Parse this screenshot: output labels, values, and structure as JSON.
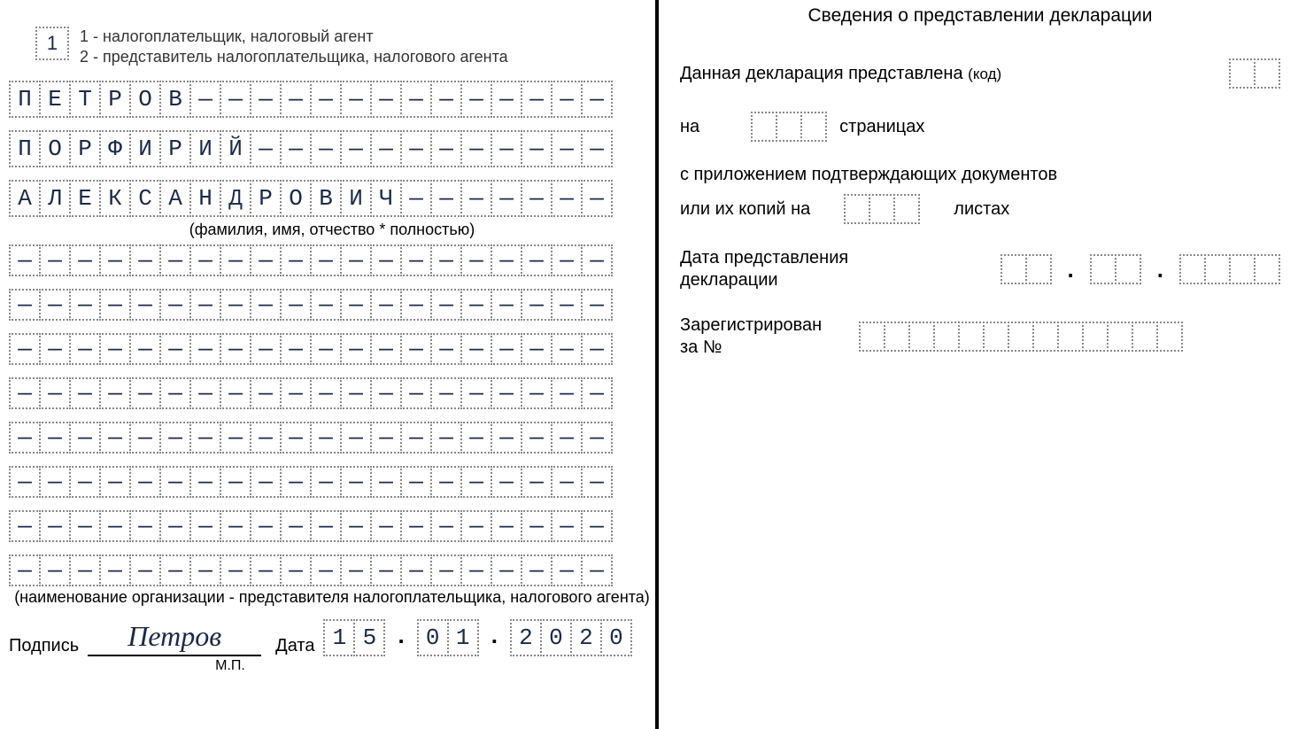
{
  "signer_type_code": "1",
  "legend_line1": "1 - налогоплательщик, налоговый агент",
  "legend_line2": "2 - представитель налогоплательщика, налогового агента",
  "surname_row": [
    "П",
    "Е",
    "Т",
    "Р",
    "О",
    "В",
    "—",
    "—",
    "—",
    "—",
    "—",
    "—",
    "—",
    "—",
    "—",
    "—",
    "—",
    "—",
    "—",
    "—"
  ],
  "name_row": [
    "П",
    "О",
    "Р",
    "Ф",
    "И",
    "Р",
    "И",
    "Й",
    "—",
    "—",
    "—",
    "—",
    "—",
    "—",
    "—",
    "—",
    "—",
    "—",
    "—",
    "—"
  ],
  "patronymic_row": [
    "А",
    "Л",
    "Е",
    "К",
    "С",
    "А",
    "Н",
    "Д",
    "Р",
    "О",
    "В",
    "И",
    "Ч",
    "—",
    "—",
    "—",
    "—",
    "—",
    "—",
    "—"
  ],
  "fio_caption": "(фамилия, имя, отчество * полностью)",
  "empty_rows_count": 8,
  "empty_row_cells": 20,
  "org_caption": "(наименование организации - представителя налогоплательщика, налогового агента)",
  "sign_label": "Подпись",
  "signature_value": "Петров",
  "date_label": "Дата",
  "mp_label": "М.П.",
  "date_dd": [
    "1",
    "5"
  ],
  "date_mm": [
    "0",
    "1"
  ],
  "date_yyyy": [
    "2",
    "0",
    "2",
    "0"
  ],
  "right": {
    "title": "Сведения о представлении декларации",
    "decl_label": "Данная декларация представлена",
    "decl_code_suffix": "(код)",
    "decl_code_cells": 2,
    "on_label": "на",
    "pages_cells": 3,
    "pages_label": "страницах",
    "attach_label": "с приложением подтверждающих документов",
    "copies_label": "или их копий на",
    "copies_cells": 3,
    "sheets_label": "листах",
    "present_date_label_1": "Дата представления",
    "present_date_label_2": "декларации",
    "present_dd_cells": 2,
    "present_mm_cells": 2,
    "present_yyyy_cells": 4,
    "reg_label_1": "Зарегистрирован",
    "reg_label_2": "за №",
    "reg_cells": 13
  }
}
